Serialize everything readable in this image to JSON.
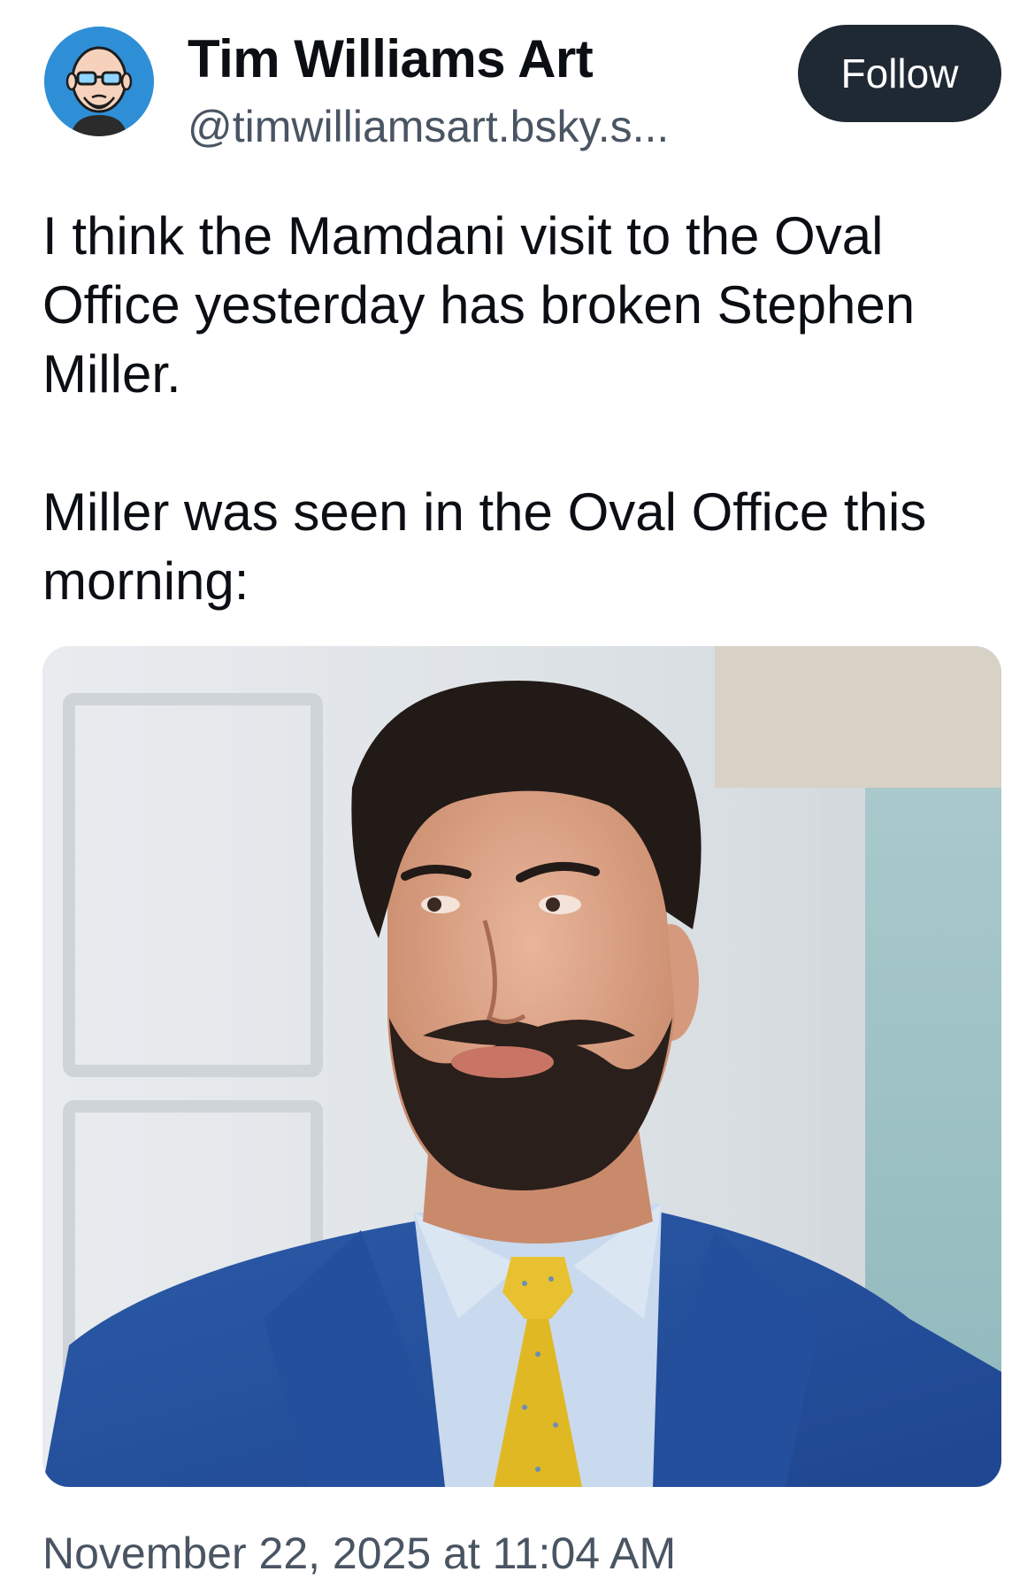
{
  "author": {
    "name": "Tim Williams Art",
    "handle": "@timwilliamsart.bsky.s..."
  },
  "follow_label": "Follow",
  "post": {
    "paragraphs": [
      "I think the Mamdani visit to the Oval Office yesterday has broken Stephen Miller.",
      "Miller was seen in the Oval Office this morning:"
    ]
  },
  "timestamp": "November 22, 2025 at 11:04 AM",
  "colors": {
    "follow_button_bg": "#1f2933",
    "avatar_bg": "#2f8fd6",
    "secondary_text": "#4a5563"
  }
}
